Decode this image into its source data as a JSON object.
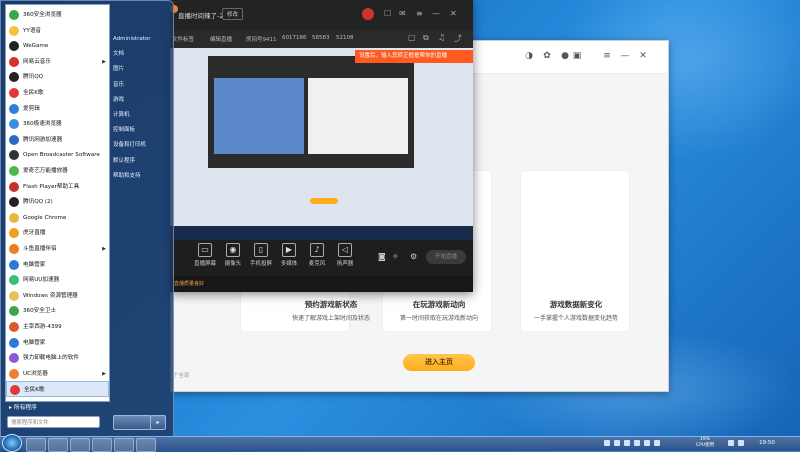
{
  "start_menu": {
    "programs": [
      {
        "label": "360安全浏览器",
        "color": "#3aa84a"
      },
      {
        "label": "YY语音",
        "color": "#f3c43b"
      },
      {
        "label": "WeGame",
        "color": "#222222"
      },
      {
        "label": "网易云音乐",
        "color": "#d4302c",
        "submenu": true
      },
      {
        "label": "腾讯QQ",
        "color": "#222222"
      },
      {
        "label": "全民K歌",
        "color": "#e0383a"
      },
      {
        "label": "爱剪辑",
        "color": "#2b7fd8"
      },
      {
        "label": "360极速浏览器",
        "color": "#3a8ee0"
      },
      {
        "label": "腾讯网游加速器",
        "color": "#2a6bc8"
      },
      {
        "label": "Open Broadcaster Software",
        "color": "#333333"
      },
      {
        "label": "爱奇艺万能播放器",
        "color": "#4db84a"
      },
      {
        "label": "Flash Player帮助工具",
        "color": "#c43030"
      },
      {
        "label": "腾讯QQ (2)",
        "color": "#222222"
      },
      {
        "label": "Google Chrome",
        "color": "#e8b93a"
      },
      {
        "label": "虎牙直播",
        "color": "#f0a020"
      },
      {
        "label": "斗鱼直播伴侣",
        "color": "#f07a20",
        "submenu": true
      },
      {
        "label": "电脑管家",
        "color": "#2a7ad8"
      },
      {
        "label": "网易UU加速器",
        "color": "#3ac07a"
      },
      {
        "label": "Windows 资源管理器",
        "color": "#e8c060"
      },
      {
        "label": "360安全卫士",
        "color": "#3aa84a"
      },
      {
        "label": "主宰西游-4399",
        "color": "#d85a2a"
      },
      {
        "label": "电脑管家",
        "color": "#2a7ad8"
      },
      {
        "label": "强力卸载电脑上的软件",
        "color": "#8a5ad8"
      },
      {
        "label": "UC浏览器",
        "color": "#f08030",
        "submenu": true
      },
      {
        "label": "全民K歌",
        "color": "#e0383a",
        "highlighted": true
      }
    ],
    "all_programs": "所有程序",
    "search_placeholder": "搜索程序和文件",
    "right_items": [
      "Administrator",
      "文档",
      "图片",
      "音乐",
      "游戏",
      "计算机",
      "控制面板",
      "设备和打印机",
      "默认程序",
      "帮助和支持"
    ]
  },
  "live_app": {
    "title": "直播时间辣了-2",
    "title_tag": "修改",
    "info_items": [
      "文件标签",
      "编辑直播",
      "房间号9411",
      "6017186",
      "58583",
      "52108"
    ],
    "notice": "设置后，输入您转正框框帮你的直播",
    "tools": [
      {
        "label": "直播屏幕",
        "icon": "▭"
      },
      {
        "label": "摄像头",
        "icon": "◉"
      },
      {
        "label": "手机投屏",
        "icon": "▯"
      },
      {
        "label": "多媒体",
        "icon": "▶"
      },
      {
        "label": "麦克风",
        "icon": "♪"
      },
      {
        "label": "扬声器",
        "icon": "◁"
      }
    ],
    "start_label": "开始直播",
    "status": "直播质量良好"
  },
  "game_window": {
    "features": [
      {
        "title": "预约游戏新状态",
        "desc": "快速了解游戏上架时间及状态"
      },
      {
        "title": "在玩游戏新动向",
        "desc": "第一时间获取在玩游戏新动向"
      },
      {
        "title": "游戏数据新变化",
        "desc": "一手掌握个人游戏数据变化趋势"
      }
    ],
    "enter_button": "进入主页",
    "footer_note": "个全部"
  },
  "taskbar": {
    "clock": "19:50",
    "tray_lines": [
      "19%",
      "CPU使用"
    ]
  },
  "colors": {
    "accent_orange": "#ffab1a",
    "notice_red": "#ff5a1f",
    "desktop_blue": "#1f7fd1"
  }
}
